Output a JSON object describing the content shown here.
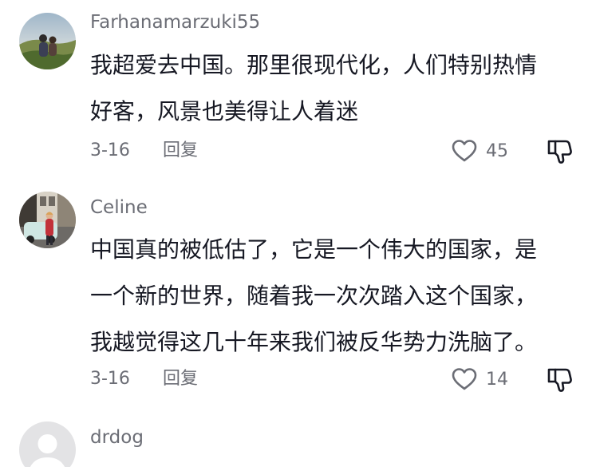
{
  "comments": [
    {
      "username": "Farhanamarzuki55",
      "lines": [
        "我超爱去中国。那里很现代化，人们特别热情",
        "好客，风景也美得让人着迷"
      ],
      "date": "3-16",
      "reply_label": "回复",
      "likes": "45",
      "avatar_icon": "landscape-photo-avatar"
    },
    {
      "username": "Celine",
      "lines": [
        "中国真的被低估了，它是一个伟大的国家，是",
        "一个新的世界，随着我一次次踏入这个国家，",
        "我越觉得这几十年来我们被反华势力洗脑了。"
      ],
      "date": "3-16",
      "reply_label": "回复",
      "likes": "14",
      "avatar_icon": "street-photo-avatar"
    },
    {
      "username": "drdog",
      "avatar_icon": "default-person-avatar"
    }
  ],
  "icons": {
    "like": "heart-outline-icon",
    "dislike": "thumbs-down-outline-icon"
  },
  "colors": {
    "text": "#161823",
    "secondary": "#6b6d75",
    "background": "#ffffff"
  }
}
